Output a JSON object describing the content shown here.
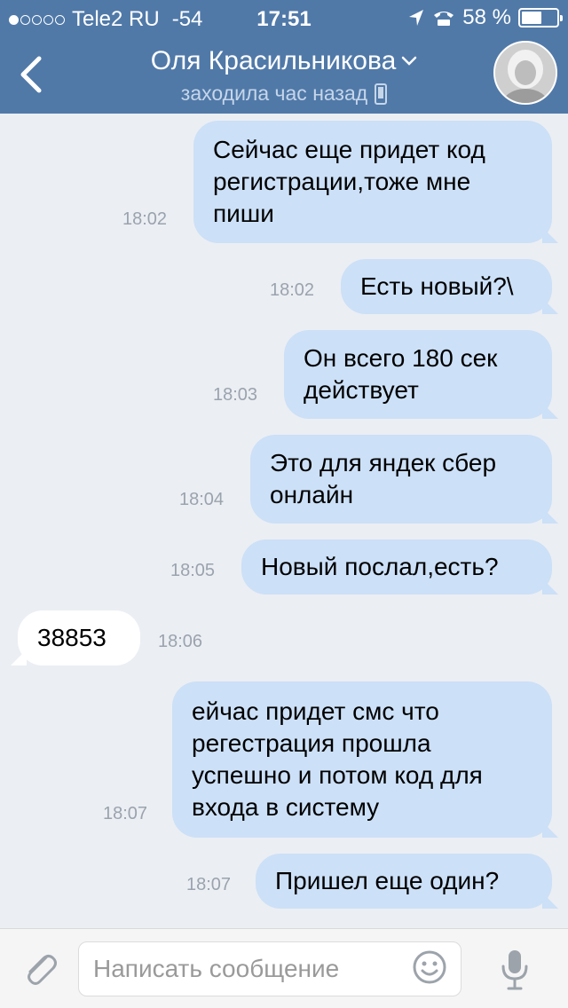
{
  "status_bar": {
    "carrier": "Tele2 RU",
    "signal_strength": "-54",
    "time": "17:51",
    "battery_text": "58 %",
    "battery_level": 0.58,
    "icons": [
      "location-arrow-icon",
      "phone-icon"
    ]
  },
  "header": {
    "title": "Оля Красильникова",
    "subtitle": "заходила час назад",
    "background_color": "#5079a8"
  },
  "messages": [
    {
      "direction": "out",
      "text": "Сейчас еще придет код регистрации,тоже мне пиши",
      "time": "18:02"
    },
    {
      "direction": "out",
      "text": "Есть новый?\\",
      "time": "18:02"
    },
    {
      "direction": "out",
      "text": "Он всего 180 сек действует",
      "time": "18:03"
    },
    {
      "direction": "out",
      "text": "Это для яндек сбер онлайн",
      "time": "18:04"
    },
    {
      "direction": "out",
      "text": "Новый послал,есть?",
      "time": "18:05"
    },
    {
      "direction": "in",
      "text": "38853",
      "time": "18:06"
    },
    {
      "direction": "out",
      "text": "ейчас придет смс что регестрация прошла успешно и потом код для входа в систему",
      "time": "18:07"
    },
    {
      "direction": "out",
      "text": "Пришел еще один?",
      "time": "18:07"
    }
  ],
  "input": {
    "placeholder": "Написать сообщение",
    "icons": [
      "paperclip-icon",
      "emoji-icon",
      "microphone-icon"
    ]
  }
}
